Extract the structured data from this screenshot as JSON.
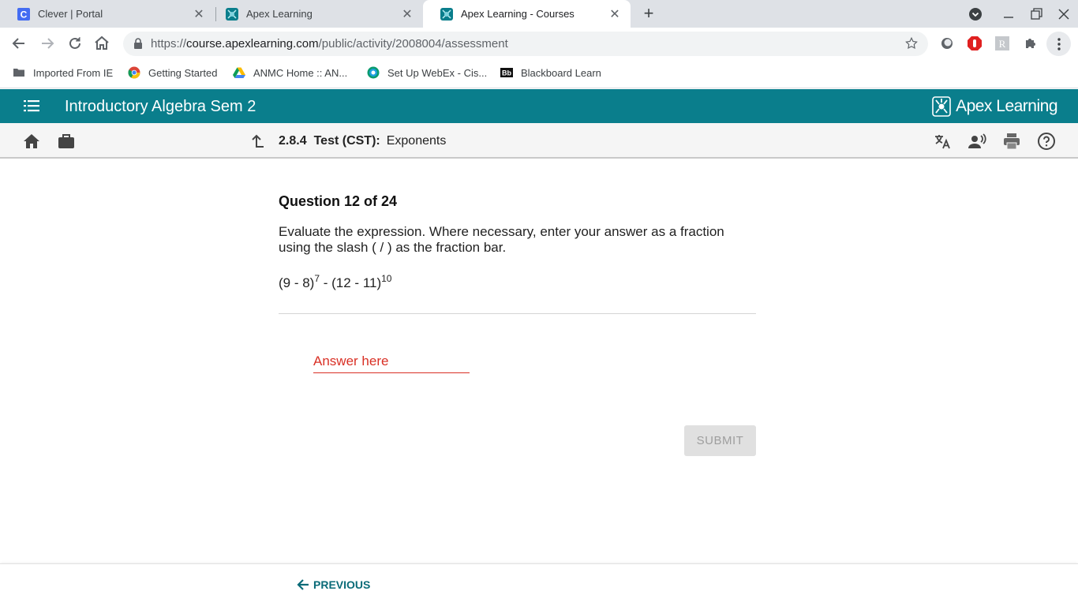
{
  "browser": {
    "tabs": [
      {
        "title": "Clever | Portal",
        "active": false
      },
      {
        "title": "Apex Learning",
        "active": false
      },
      {
        "title": "Apex Learning - Courses",
        "active": true
      }
    ],
    "url_prefix": "https://",
    "url_host": "course.apexlearning.com",
    "url_path": "/public/activity/2008004/assessment",
    "bookmarks": [
      {
        "label": "Imported From IE",
        "icon": "folder-icon"
      },
      {
        "label": "Getting Started",
        "icon": "chrome-icon"
      },
      {
        "label": "ANMC Home :: AN...",
        "icon": "drive-icon"
      },
      {
        "label": "Set Up WebEx - Cis...",
        "icon": "webex-icon"
      },
      {
        "label": "Blackboard Learn",
        "icon": "blackboard-icon"
      }
    ]
  },
  "app": {
    "course_title": "Introductory Algebra Sem 2",
    "brand": "Apex Learning",
    "accent": "#0a7e8c"
  },
  "breadcrumb": {
    "number": "2.8.4",
    "kind": "Test (CST):",
    "name": "Exponents"
  },
  "question": {
    "heading": "Question 12 of 24",
    "prompt": "Evaluate the expression. Where necessary, enter your answer as a fraction using the slash ( / ) as the fraction bar.",
    "expr_part1": "(9 - 8)",
    "exp1": "7",
    "expr_part2": " - (12 - 11)",
    "exp2": "10"
  },
  "answer": {
    "placeholder": "Answer here",
    "value": ""
  },
  "buttons": {
    "submit": "SUBMIT",
    "previous": "PREVIOUS"
  }
}
